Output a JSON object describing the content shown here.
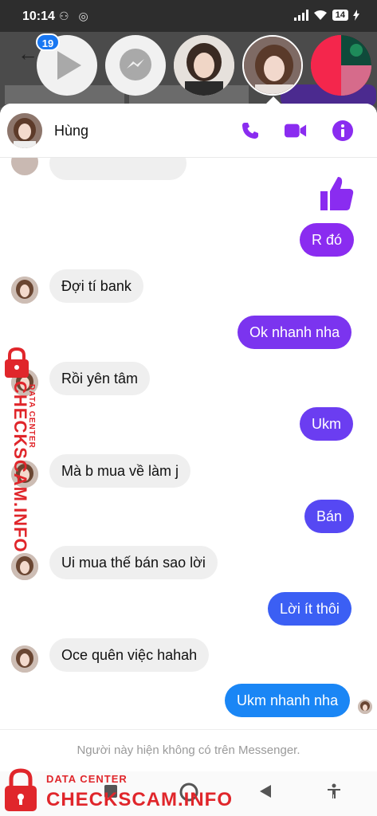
{
  "status_bar": {
    "time": "10:14",
    "battery": "14"
  },
  "chat_heads": {
    "badge_count": "19"
  },
  "chat": {
    "contact_name": "Hùng",
    "messages": [
      {
        "side": "out",
        "type": "like"
      },
      {
        "side": "out",
        "text": "R đó"
      },
      {
        "side": "in",
        "text": "Đợi tí bank"
      },
      {
        "side": "out",
        "text": "Ok nhanh nha"
      },
      {
        "side": "in",
        "text": "Rồi yên tâm"
      },
      {
        "side": "out",
        "text": "Ukm"
      },
      {
        "side": "in",
        "text": "Mà b mua về làm j"
      },
      {
        "side": "out",
        "text": "Bán"
      },
      {
        "side": "in",
        "text": "Ui mua thế bán sao lời"
      },
      {
        "side": "out",
        "text": "Lời ít thôi"
      },
      {
        "side": "in",
        "text": "Oce quên việc hahah"
      },
      {
        "side": "out",
        "text": "Ukm nhanh nha"
      }
    ],
    "notice": "Người này hiện không có trên Messenger.",
    "colors": {
      "outgoing_top": "#8a2cf0",
      "outgoing_bottom": "#1a86f5",
      "accent": "#8a2cf0"
    }
  },
  "watermark": {
    "brand": "CHECKSCAM.INFO",
    "tagline": "DATA CENTER"
  }
}
